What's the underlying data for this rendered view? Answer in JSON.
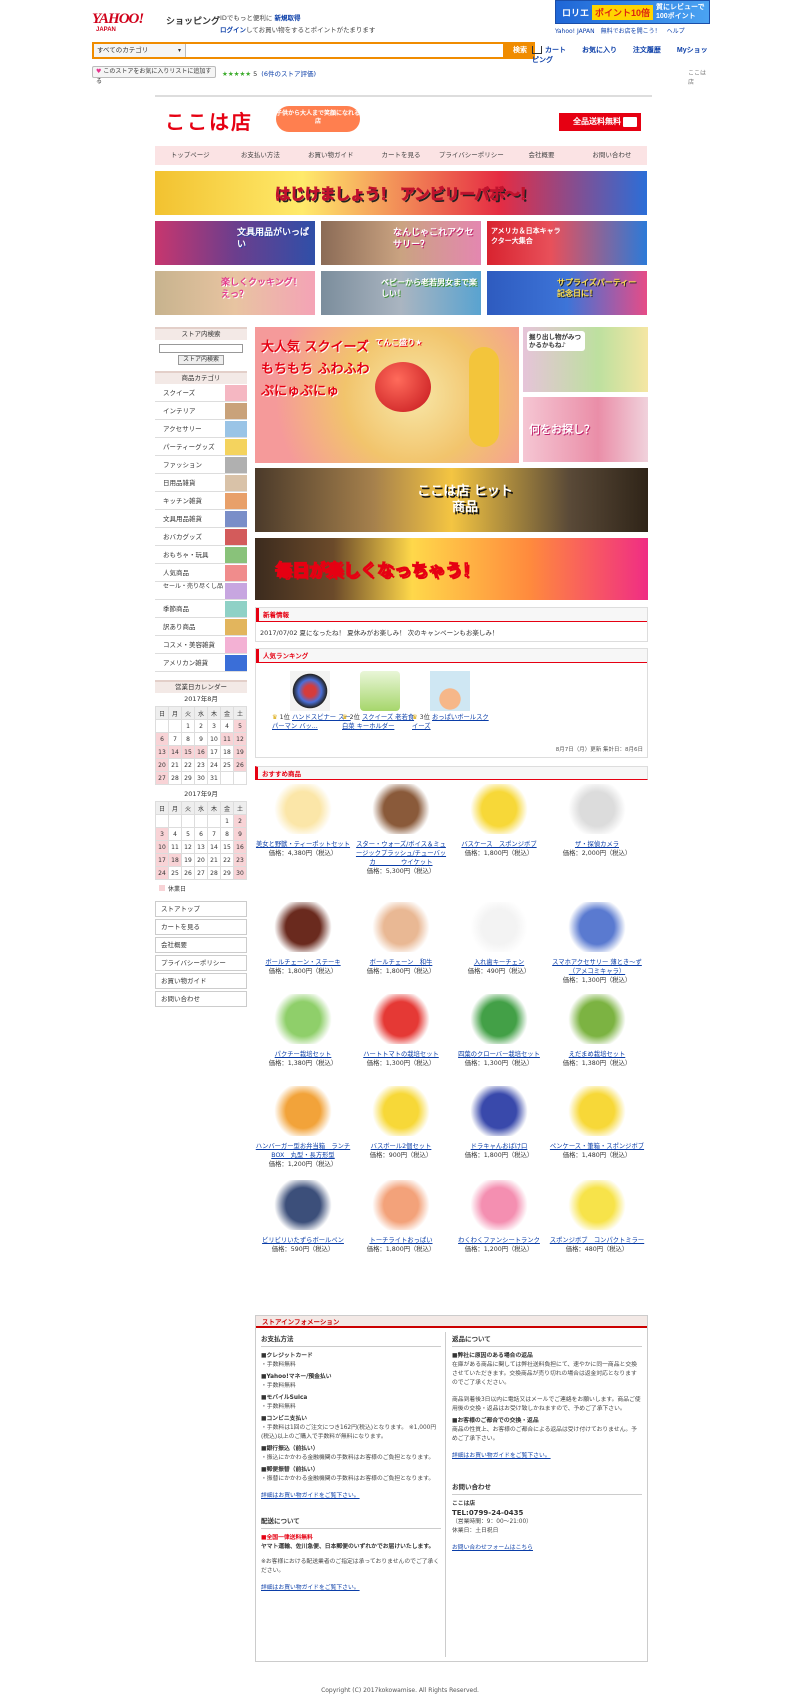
{
  "yahoo": {
    "logo": "YAHOO!",
    "logo_sub": "JAPAN",
    "shop": "ショッピング",
    "line1_pre": "IDでもっと便利に",
    "line1_link": "新規取得",
    "line2_link": "ログイン",
    "line2_post": "してお買い物をするとポイントがたまります",
    "ad_brand": "ロリエ",
    "ad_points": "ポイント10倍",
    "ad_right": "質にレビューで100ポイント",
    "links_right": "Yahoo! JAPAN　無料でお店を開こう！　ヘルプ",
    "search_category": "すべてのカテゴリ",
    "search_placeholder": "",
    "search_button": "検索",
    "nav": [
      "カート",
      "お気に入り",
      "注文履歴",
      "Myショッピング"
    ],
    "add_fav": "このストアをお気に入りリストに追加する",
    "stars": "★★★★★",
    "rating": "5",
    "review_count": "(6件のストア評価)",
    "store_name_small": "ここは店"
  },
  "store": {
    "logo": "ここは店",
    "bubble": "子供から大人まで笑顔になれる店",
    "free_ship": "全品送料無料",
    "nav": [
      "トップページ",
      "お支払い方法",
      "お買い物ガイド",
      "カートを見る",
      "プライバシーポリシー",
      "会社概要",
      "お問い合わせ"
    ],
    "banner_top": "はじけましょう！ アンビリーバボ〜！",
    "banners_row1": [
      "文具用品がいっぱい",
      "なんじゃこれアクセサリー？",
      "アメリカ＆日本キャラクター大集合"
    ],
    "banners_row2": [
      "楽しくクッキング！えっ？",
      "ベビーから老若男女まで楽しい！",
      "サプライズパーティー 記念日に！"
    ],
    "main_banner": "大人気 スクイーズ もちもち ふわふわ ぷにゅぷにゅ",
    "main_banner_sub": "てんこ盛り★",
    "side_banner1": "掘り出し物がみつかるかもね♪",
    "side_banner2": "何をお探し？",
    "hit_banner": "ここは店 ヒット商品",
    "daily_banner": "毎日が楽しくなっちゃう！"
  },
  "sidebar": {
    "search_title": "ストア内検索",
    "search_button": "ストア内検索",
    "cat_title": "商品カテゴリ",
    "categories": [
      "スクイーズ",
      "インテリア",
      "アクセサリー",
      "パーティーグッズ",
      "ファッション",
      "日用品雑貨",
      "キッチン雑貨",
      "文具用品雑貨",
      "おバカグッズ",
      "おもちゃ・玩具",
      "人気商品",
      "セール・売り尽くし品",
      "季節商品",
      "訳あり商品",
      "コスメ・美容雑貨",
      "アメリカン雑貨"
    ],
    "cal_title": "営業日カレンダー",
    "cal_aug": "2017年8月",
    "cal_sep": "2017年9月",
    "weekdays": [
      "日",
      "月",
      "火",
      "水",
      "木",
      "金",
      "土"
    ],
    "holiday_legend": "休業日",
    "links": [
      "ストアトップ",
      "カートを見る",
      "会社概要",
      "プライバシーポリシー",
      "お買い物ガイド",
      "お問い合わせ"
    ]
  },
  "news": {
    "title": "新着情報",
    "text": "2017/07/02 夏になったね！ 夏休みがお楽しみ！ 次のキャンペーンもお楽しみ！"
  },
  "ranking": {
    "title": "人気ランキング",
    "items": [
      {
        "rank": "1位",
        "name": "ハンドスピナー スーパーマン バッ..."
      },
      {
        "rank": "2位",
        "name": "スクイーズ 老若食 白菜 キーホルダー"
      },
      {
        "rank": "3位",
        "name": "おっぱいボールスクイーズ"
      }
    ],
    "updated": "8月7日（月）更新 集計日：8月6日"
  },
  "products": {
    "title": "おすすめ商品",
    "items": [
      {
        "name": "美女と野獣・ティーポットセット",
        "price": "価格：4,380円（税込）"
      },
      {
        "name": "スター・ウォーズ/ボイス＆ミュージックプラッシュ/チューバッカ　　　　ウイケット",
        "price": "価格：5,300円（税込）"
      },
      {
        "name": "バスケース　スポンジボブ",
        "price": "価格：1,800円（税込）"
      },
      {
        "name": "ザ・探偵カメラ",
        "price": "価格：2,000円（税込）"
      },
      {
        "name": "ボールチェーン・ステーキ",
        "price": "価格：1,800円（税込）"
      },
      {
        "name": "ボールチェーン　和牛",
        "price": "価格：1,800円（税込）"
      },
      {
        "name": "入れ歯キーチェン",
        "price": "価格：490円（税込）"
      },
      {
        "name": "スマホアクセサリー 薄とき〜ず（アメコミキャラ）",
        "price": "価格：1,300円（税込）"
      },
      {
        "name": "パクチー栽培セット",
        "price": "価格：1,380円（税込）"
      },
      {
        "name": "ハートトマトの栽培セット",
        "price": "価格：1,300円（税込）"
      },
      {
        "name": "四葉のクローバー栽培セット",
        "price": "価格：1,300円（税込）"
      },
      {
        "name": "えだまめ栽培セット",
        "price": "価格：1,380円（税込）"
      },
      {
        "name": "ハンバーガー型お弁当箱　ランチBOX　丸型・長方形型",
        "price": "価格：1,200円（税込）"
      },
      {
        "name": "バスボール2個セット",
        "price": "価格：900円（税込）"
      },
      {
        "name": "ドラキャんおばけ口",
        "price": "価格：1,800円（税込）"
      },
      {
        "name": "ペンケース・筆箱・スポンジボブ",
        "price": "価格：1,480円（税込）"
      },
      {
        "name": "ビリビリいたずらボールペン",
        "price": "価格：590円（税込）"
      },
      {
        "name": "トーチライトおっぱい",
        "price": "価格：1,800円（税込）"
      },
      {
        "name": "わくわくファンシートランク",
        "price": "価格：1,200円（税込）"
      },
      {
        "name": "スポンジボブ　コンパクトミラー",
        "price": "価格：480円（税込）"
      }
    ]
  },
  "info": {
    "title": "ストアインフォメーション",
    "pay_title": "お支払方法",
    "pay": [
      {
        "h": "■クレジットカード",
        "t": "・手数料無料"
      },
      {
        "h": "■Yahoo!マネー/預金払い",
        "t": "・手数料無料"
      },
      {
        "h": "■モバイルSuica",
        "t": "・手数料無料"
      },
      {
        "h": "■コンビニ支払い",
        "t": "・手数料は1回のご注文につき162円(税込)となります。 ※1,000円(税込)以上のご購入で手数料が無料になります。"
      },
      {
        "h": "■銀行振込（前払い）",
        "t": "・振込にかかわる金融機関の手数料はお客様のご負担となります。"
      },
      {
        "h": "■郵便振替（前払い）",
        "t": "・振替にかかわる金融機関の手数料はお客様のご負担となります。"
      }
    ],
    "pay_more": "詳細はお買い物ガイドをご覧下さい。",
    "ship_title": "配送について",
    "ship_red": "■全国一律送料無料",
    "ship_text": "ヤマト運輸、佐川急便、日本郵便のいずれかでお届けいたします。",
    "ship_note": "※お客様における配送業者のご指定は承っておりませんのでご了承ください。",
    "ship_more": "詳細はお買い物ガイドをご覧下さい。",
    "ret_title": "返品について",
    "ret": [
      {
        "h": "■弊社に原因のある場合の返品",
        "t": "在庫がある商品に関しては弊社送料負担にて、速やかに同一商品と交換させていただきます。交換商品が売り切れの場合は返金対応となりますのでご了承ください。"
      },
      {
        "h": "",
        "t": "商品到着後3日以内に電話又はメールでご連絡をお願いします。商品ご使用後の交換・返品はお受け致しかねますので、予めご了承下さい。"
      },
      {
        "h": "■お客様のご都合での交換・返品",
        "t": "商品の性質上、お客様のご都合による返品は受け付けておりません。予めご了承下さい。"
      }
    ],
    "ret_more": "詳細はお買い物ガイドをご覧下さい。",
    "contact_title": "お問い合わせ",
    "contact_name": "ここは店",
    "contact_tel": "TEL:0799-24-0435",
    "contact_hours": "（営業時間：9：00～21:00）",
    "contact_closed": "休業日：土日祝日",
    "contact_link": "お問い合わせフォームはこちら"
  },
  "copyright": "Copyright (C) 2017kokowamise. All Rights Reserved."
}
